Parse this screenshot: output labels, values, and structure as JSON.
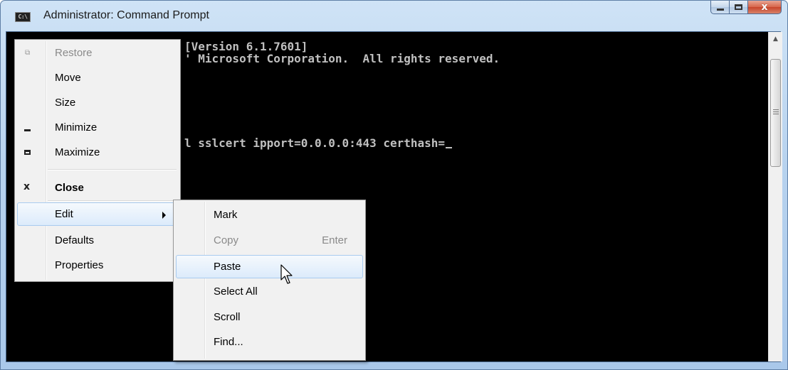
{
  "window": {
    "title": "Administrator: Command Prompt",
    "icon_label": "C:\\",
    "caption_buttons": {
      "minimize": "minimize",
      "maximize": "maximize",
      "close": "x"
    }
  },
  "console": {
    "lines": [
      "[Version 6.1.7601]",
      "' Microsoft Corporation.  All rights reserved.",
      "",
      "",
      "",
      "",
      "",
      "",
      "l sslcert ipport=0.0.0.0:443 certhash="
    ],
    "colors": {
      "background": "#000000",
      "text": "#c0c0c0"
    }
  },
  "system_menu": {
    "items": [
      {
        "label": "Restore",
        "icon": "restore-icon",
        "disabled": true
      },
      {
        "label": "Move",
        "icon": "",
        "disabled": false
      },
      {
        "label": "Size",
        "icon": "",
        "disabled": false
      },
      {
        "label": "Minimize",
        "icon": "minimize-icon",
        "disabled": false
      },
      {
        "label": "Maximize",
        "icon": "maximize-icon",
        "disabled": false
      },
      {
        "label": "Close",
        "icon": "close-icon",
        "bold": true
      },
      {
        "label": "Edit",
        "submenu": true,
        "highlighted": true
      },
      {
        "label": "Defaults"
      },
      {
        "label": "Properties"
      }
    ]
  },
  "edit_submenu": {
    "items": [
      {
        "label": "Mark"
      },
      {
        "label": "Copy",
        "accelerator": "Enter",
        "disabled": true
      },
      {
        "label": "Paste",
        "highlighted": true
      },
      {
        "label": "Select All"
      },
      {
        "label": "Scroll"
      },
      {
        "label": "Find..."
      }
    ]
  },
  "colors": {
    "menu_highlight_border": "#a9cbef",
    "close_button": "#c7452b",
    "title_bar": "#b7d2ee"
  }
}
